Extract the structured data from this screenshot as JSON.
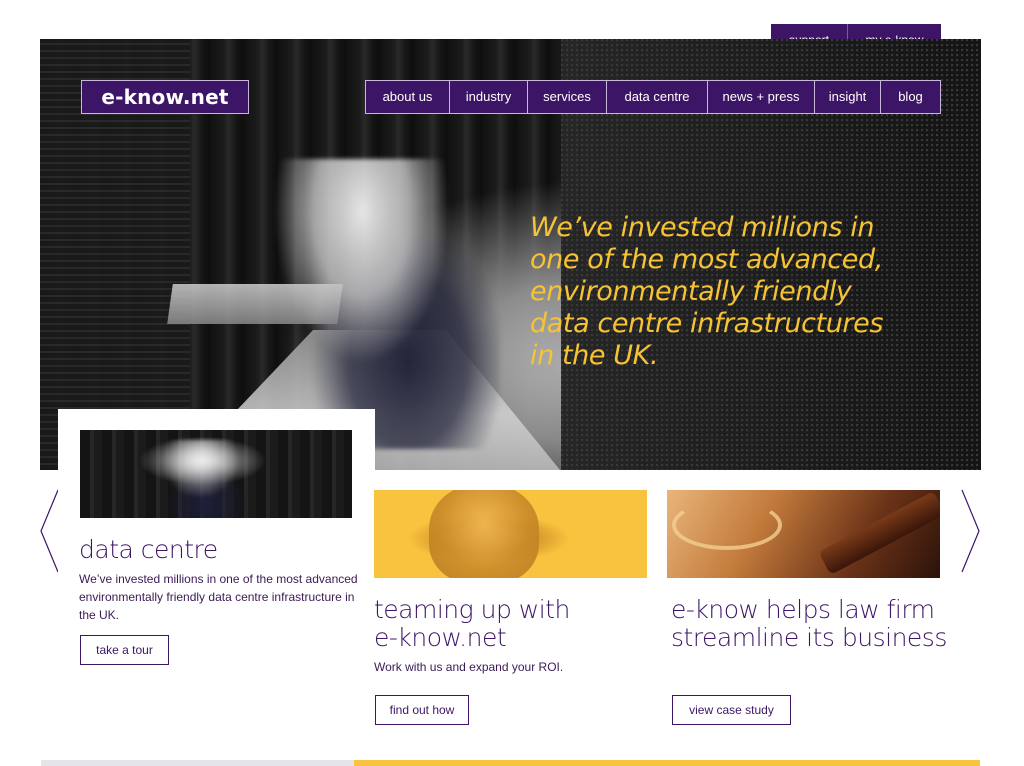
{
  "utility_nav": {
    "support": "support",
    "my_eknow": "my e-know"
  },
  "logo": {
    "text": "e-know.net"
  },
  "nav": {
    "items": [
      {
        "label": "about us"
      },
      {
        "label": "industry"
      },
      {
        "label": "services"
      },
      {
        "label": "data centre"
      },
      {
        "label": "news + press"
      },
      {
        "label": "insight"
      },
      {
        "label": "blog"
      }
    ]
  },
  "hero": {
    "headline_lines": [
      "We’ve invested millions in",
      "one of the most advanced,",
      "environmentally friendly",
      "data centre infrastructures",
      "in the UK."
    ]
  },
  "cards": [
    {
      "title": "data centre",
      "text": "We’ve invested millions in one of the most advanced environmentally friendly data centre infrastructure in the UK.",
      "button": "take a tour"
    },
    {
      "title_lines": [
        "teaming up with",
        "e-know.net"
      ],
      "text": "Work with us and expand your ROI.",
      "button": "find out how"
    },
    {
      "title_lines": [
        "e-know helps law firm",
        "streamline its business"
      ],
      "button": "view case study"
    }
  ],
  "colors": {
    "brand_purple": "#3d1566",
    "accent_yellow": "#f8c33f",
    "headline_yellow": "#f6c335"
  },
  "icons": {
    "prev": "chevron-left-icon",
    "next": "chevron-right-icon"
  }
}
